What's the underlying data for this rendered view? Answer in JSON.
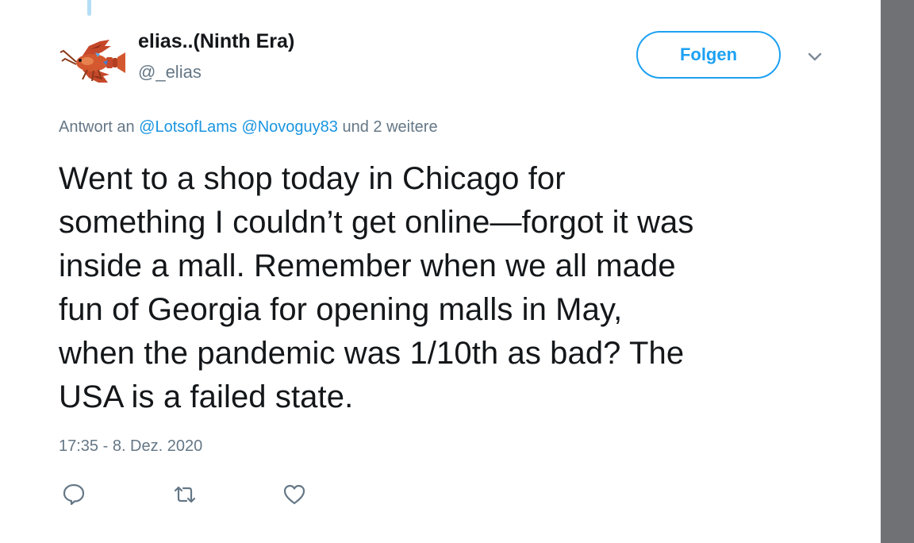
{
  "author": {
    "display_name": "elias..(Ninth Era)",
    "handle": "@_elias",
    "avatar_icon": "lobster-avatar-icon"
  },
  "follow_button": {
    "label": "Folgen"
  },
  "more_menu": {
    "icon": "chevron-down-icon"
  },
  "reply_context": {
    "prefix": "Antwort an",
    "mention_1": "@LotsofLams",
    "mention_2": "@Novoguy83",
    "suffix": "und 2 weitere"
  },
  "tweet": {
    "lines": [
      "Went to a shop today in Chicago for",
      "something I couldn’t get online—forgot it was",
      "inside a mall. Remember when we all made",
      "fun of Georgia for opening malls in May,",
      "when the pandemic was 1/10th as bad? The",
      "USA is a failed state."
    ],
    "timestamp": "17:35 - 8. Dez. 2020"
  },
  "actions": {
    "reply_icon": "reply-icon",
    "retweet_icon": "retweet-icon",
    "like_icon": "heart-icon"
  },
  "colors": {
    "accent": "#1da1f2",
    "link": "#1b95e0",
    "secondary_text": "#657786",
    "primary_text": "#14171a",
    "side_panel": "#6f7175"
  }
}
